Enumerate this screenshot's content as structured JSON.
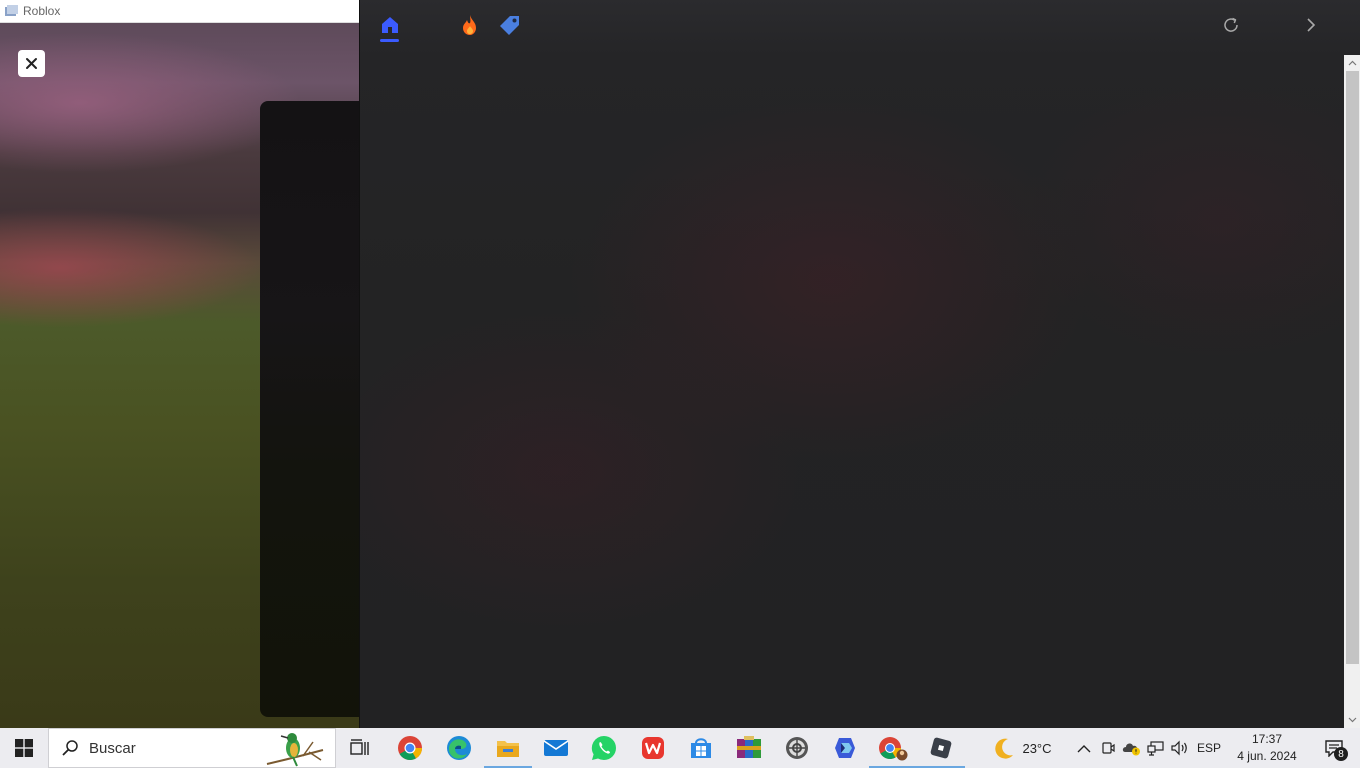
{
  "roblox_window": {
    "title": "Roblox",
    "close_icon": "close-icon"
  },
  "overlay": {
    "nav": [
      {
        "icon": "home-icon",
        "active": true,
        "color": "#3b5bff"
      },
      {
        "icon": "fire-icon",
        "color": "#ff6a1a"
      },
      {
        "icon": "tag-icon",
        "color": "#4a7fe0"
      },
      {
        "icon": "refresh-icon",
        "color": "#aaaaaa"
      },
      {
        "icon": "chevron-right-icon",
        "color": "#aaaaaa"
      }
    ]
  },
  "taskbar": {
    "search_placeholder": "Buscar",
    "apps": [
      "task-view-icon",
      "chrome-icon",
      "edge-icon",
      "file-explorer-icon",
      "mail-icon",
      "whatsapp-icon",
      "wps-office-icon",
      "microsoft-store-icon",
      "winrar-icon",
      "app-icon",
      "copilot-icon",
      "chrome-profile-icon",
      "roblox-icon"
    ],
    "weather": {
      "temp": "23°C",
      "icon": "moon-icon"
    },
    "language": "ESP",
    "time": "17:37",
    "date": "4 jun. 2024",
    "notification_count": "8"
  }
}
